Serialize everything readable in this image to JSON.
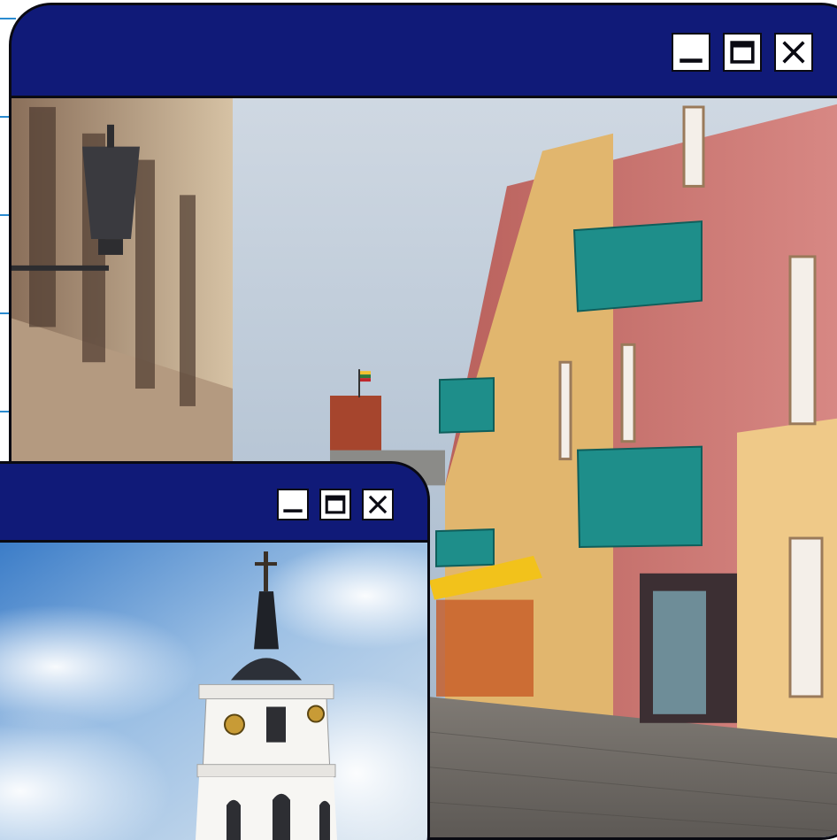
{
  "windows": {
    "back": {
      "controls": [
        "minimize-icon",
        "maximize-icon",
        "close-icon"
      ],
      "image": "old-town-street-with-pink-buildings-and-red-brick-tower"
    },
    "front": {
      "controls": [
        "minimize-icon",
        "maximize-icon",
        "close-icon"
      ],
      "image": "white-bell-tower-with-cross-and-clocks-under-cloudy-sky"
    }
  },
  "colors": {
    "titlebar": "#101a78",
    "outline": "#0a0a12",
    "control_bg": "#ffffff"
  }
}
